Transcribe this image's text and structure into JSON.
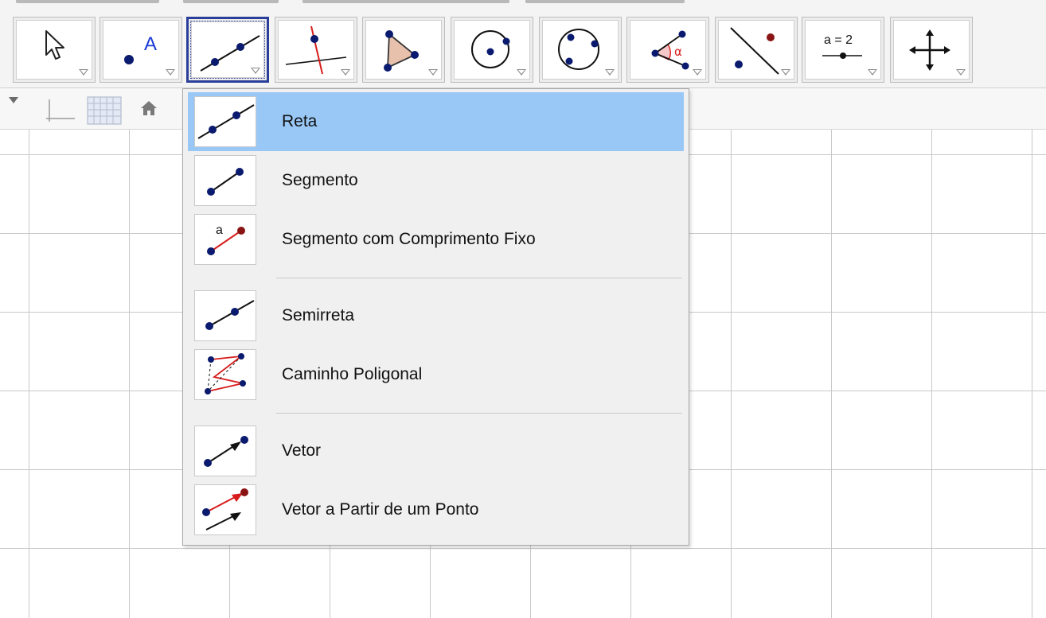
{
  "toolbar": {
    "tools": [
      {
        "icon": "move-arrow-icon",
        "selected": false
      },
      {
        "icon": "point-icon",
        "label": "A",
        "selected": false
      },
      {
        "icon": "line-icon",
        "selected": true
      },
      {
        "icon": "perpendicular-line-icon",
        "selected": false
      },
      {
        "icon": "polygon-icon",
        "selected": false
      },
      {
        "icon": "circle-center-point-icon",
        "selected": false
      },
      {
        "icon": "circle-three-points-icon",
        "selected": false
      },
      {
        "icon": "angle-icon",
        "label": "α",
        "selected": false
      },
      {
        "icon": "reflect-about-line-icon",
        "selected": false
      },
      {
        "icon": "slider-icon",
        "label": "a = 2",
        "selected": false
      },
      {
        "icon": "move-view-icon",
        "selected": false
      }
    ]
  },
  "subbar": {
    "icons": [
      "style-bar-toggle-icon",
      "axes-toggle-icon",
      "grid-toggle-icon",
      "home-view-icon"
    ]
  },
  "menu": {
    "items": [
      {
        "label": "Reta",
        "icon": "line-icon",
        "selected": true
      },
      {
        "label": "Segmento",
        "icon": "segment-icon",
        "selected": false
      },
      {
        "label": "Segmento com Comprimento Fixo",
        "icon": "segment-fixed-length-icon",
        "icon_label": "a",
        "selected": false
      },
      {
        "label": "Semirreta",
        "icon": "ray-icon",
        "selected": false
      },
      {
        "label": "Caminho Poligonal",
        "icon": "polyline-icon",
        "selected": false
      },
      {
        "label": "Vetor",
        "icon": "vector-icon",
        "selected": false
      },
      {
        "label": "Vetor a Partir de um Ponto",
        "icon": "vector-from-point-icon",
        "selected": false
      }
    ]
  },
  "colors": {
    "point": "#0a1a6e",
    "highlight": "#99c8f6",
    "accent_red": "#d81c1c",
    "active_border": "#2a3f9a"
  }
}
